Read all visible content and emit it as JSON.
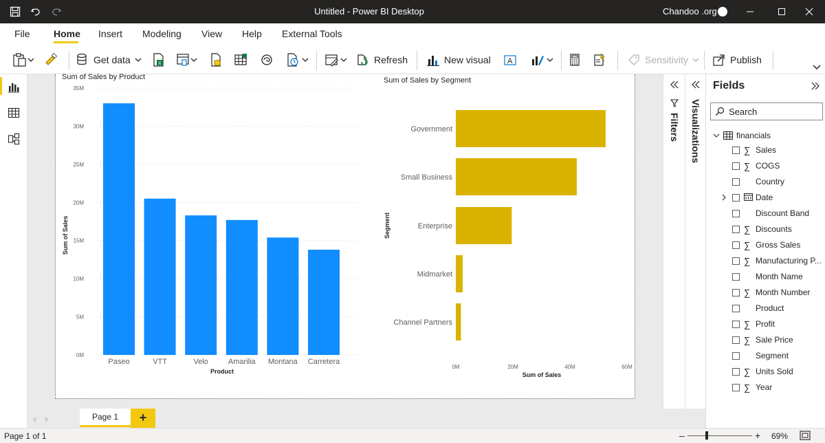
{
  "window": {
    "title": "Untitled - Power BI Desktop",
    "user": "Chandoo .org"
  },
  "menu": {
    "items": [
      "File",
      "Home",
      "Insert",
      "Modeling",
      "View",
      "Help",
      "External Tools"
    ],
    "active": "Home"
  },
  "ribbon": {
    "get_data": "Get data",
    "refresh": "Refresh",
    "new_visual": "New visual",
    "sensitivity": "Sensitivity",
    "publish": "Publish"
  },
  "panes": {
    "filters": "Filters",
    "visualizations": "Visualizations"
  },
  "fields": {
    "title": "Fields",
    "search_placeholder": "Search",
    "table": "financials",
    "items": [
      {
        "label": "Sales",
        "type": "sigma"
      },
      {
        "label": "COGS",
        "type": "sigma"
      },
      {
        "label": "Country",
        "type": "text"
      },
      {
        "label": "Date",
        "type": "date"
      },
      {
        "label": "Discount Band",
        "type": "text"
      },
      {
        "label": "Discounts",
        "type": "sigma"
      },
      {
        "label": "Gross Sales",
        "type": "sigma"
      },
      {
        "label": "Manufacturing P...",
        "type": "sigma"
      },
      {
        "label": "Month Name",
        "type": "text"
      },
      {
        "label": "Month Number",
        "type": "sigma"
      },
      {
        "label": "Product",
        "type": "text"
      },
      {
        "label": "Profit",
        "type": "sigma"
      },
      {
        "label": "Sale Price",
        "type": "sigma"
      },
      {
        "label": "Segment",
        "type": "text"
      },
      {
        "label": "Units Sold",
        "type": "sigma"
      },
      {
        "label": "Year",
        "type": "sigma"
      }
    ]
  },
  "pages": {
    "tab": "Page 1",
    "add": "+",
    "status": "Page 1 of 1",
    "zoom": "69%"
  },
  "colors": {
    "product_bar": "#118dff",
    "segment_bar": "#d9b300",
    "accent": "#f2c811"
  },
  "chart_data": [
    {
      "type": "bar",
      "title": "Sum of Sales by Product",
      "xlabel": "Product",
      "ylabel": "Sum of Sales",
      "categories": [
        "Paseo",
        "VTT",
        "Velo",
        "Amarilia",
        "Montana",
        "Carretera"
      ],
      "values": [
        33.0,
        20.5,
        18.3,
        17.7,
        15.4,
        13.8
      ],
      "unit": "M",
      "ylim": [
        0,
        35
      ],
      "ticks": [
        "0M",
        "5M",
        "10M",
        "15M",
        "20M",
        "25M",
        "30M",
        "35M"
      ],
      "grid": true
    },
    {
      "type": "bar",
      "orientation": "horizontal",
      "title": "Sum of Sales by Segment",
      "xlabel": "Sum of Sales",
      "ylabel": "Segment",
      "categories": [
        "Government",
        "Small Business",
        "Enterprise",
        "Midmarket",
        "Channel Partners"
      ],
      "values": [
        52.5,
        42.4,
        19.6,
        2.4,
        1.8
      ],
      "unit": "M",
      "xlim": [
        0,
        60
      ],
      "ticks": [
        "0M",
        "20M",
        "40M",
        "60M"
      ],
      "grid": false
    }
  ]
}
